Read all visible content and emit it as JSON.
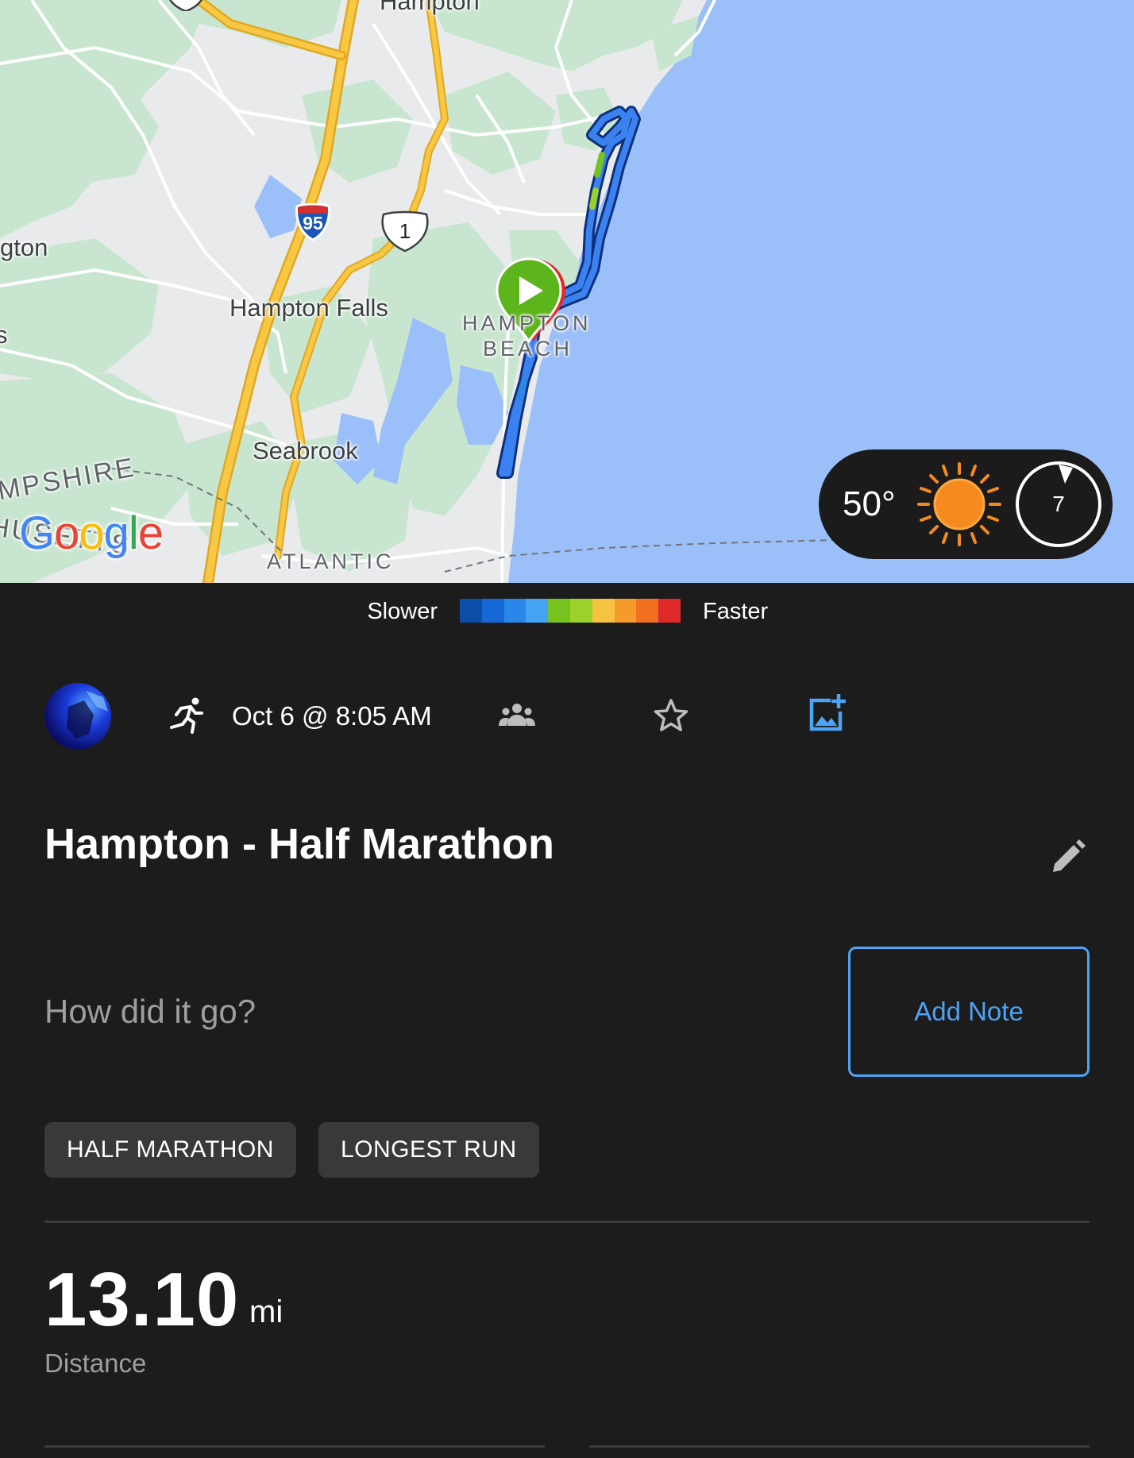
{
  "map": {
    "labels": {
      "hampton": "Hampton",
      "hampton_partial_left": "gton",
      "s_partial": "s",
      "hampton_falls": "Hampton Falls",
      "hampton_beach_line1": "HAMPTON",
      "hampton_beach_line2": "BEACH",
      "seabrook": "Seabrook",
      "state_line1": "MPSHIRE",
      "state_line2": "HUSETTS",
      "atlantic": "ATLANTIC"
    },
    "shields": {
      "interstate": "95",
      "us_route": "1"
    },
    "attribution": "Google",
    "colors": {
      "water": "#9bbff8",
      "land": "#e9eaec",
      "park": "#c8e6cf",
      "highway": "#f8c844",
      "route": "#3b82f0"
    }
  },
  "weather": {
    "temperature": "50°",
    "condition_icon": "sun-icon",
    "wind_speed": "7"
  },
  "pace_legend": {
    "slower_label": "Slower",
    "faster_label": "Faster",
    "colors": [
      "#0a4ea8",
      "#1668d6",
      "#2b86ea",
      "#46a3f2",
      "#76c31f",
      "#9ad22b",
      "#f5c242",
      "#f59b2b",
      "#f0701f",
      "#e02a2a"
    ]
  },
  "activity": {
    "date": "Oct 6 @ 8:05 AM",
    "type_icon": "running-icon",
    "title": "Hampton - Half Marathon",
    "note_prompt": "How did it go?",
    "add_note_label": "Add Note",
    "tags": [
      "HALF MARATHON",
      "LONGEST RUN"
    ]
  },
  "stats": {
    "distance_value": "13.10",
    "distance_unit": "mi",
    "distance_label": "Distance"
  }
}
